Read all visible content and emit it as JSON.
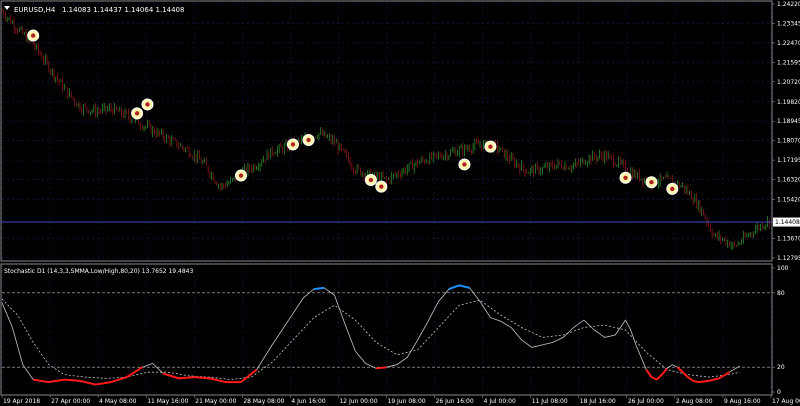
{
  "header": {
    "symbol": "EURUSD,H4",
    "ohlc": "1.14083 1.14437 1.14064 1.14408"
  },
  "indicator": {
    "title": "Stochastic D1 (14,3,3,SMMA,Low/High,80,20) 13.7652 19.4843"
  },
  "colors": {
    "background": "#000000",
    "grid": "#1a1a5a",
    "bull_candle": "#2e8b2e",
    "bear_candle": "#8b1a1a",
    "stoch_main": "#c8c8c8",
    "stoch_signal": "#c8c8c8",
    "overbought_highlight": "#1e90ff",
    "oversold_highlight": "#ff1a1a",
    "level_line": "#bbbbbb",
    "current_price_line": "#4444cc",
    "signal_marker_fill": "#fff6b0"
  },
  "chart_data": [
    {
      "type": "candlestick",
      "panel": "price",
      "ylim": [
        1.1279,
        1.2422
      ],
      "y_ticks": [
        "1.24220",
        "1.23345",
        "1.22470",
        "1.21595",
        "1.20720",
        "1.19820",
        "1.18945",
        "1.18070",
        "1.17195",
        "1.16320",
        "1.15420",
        "1.14408",
        "1.13670",
        "1.12795"
      ],
      "current_price": 1.14408,
      "current_price_label": "1.14408",
      "close_path": [
        [
          0,
          1.239
        ],
        [
          3,
          1.231
        ],
        [
          6,
          1.224
        ],
        [
          9,
          1.214
        ],
        [
          12,
          1.204
        ],
        [
          15,
          1.196
        ],
        [
          18,
          1.194
        ],
        [
          21,
          1.195
        ],
        [
          24,
          1.192
        ],
        [
          27,
          1.188
        ],
        [
          30,
          1.184
        ],
        [
          33,
          1.18
        ],
        [
          36,
          1.176
        ],
        [
          39,
          1.17
        ],
        [
          42,
          1.16
        ],
        [
          44,
          1.162
        ],
        [
          46,
          1.166
        ],
        [
          49,
          1.17
        ],
        [
          52,
          1.176
        ],
        [
          55,
          1.178
        ],
        [
          58,
          1.181
        ],
        [
          61,
          1.184
        ],
        [
          64,
          1.18
        ],
        [
          66,
          1.174
        ],
        [
          68,
          1.168
        ],
        [
          71,
          1.165
        ],
        [
          74,
          1.163
        ],
        [
          77,
          1.167
        ],
        [
          80,
          1.171
        ],
        [
          83,
          1.173
        ],
        [
          86,
          1.175
        ],
        [
          89,
          1.177
        ],
        [
          92,
          1.179
        ],
        [
          95,
          1.178
        ],
        [
          98,
          1.172
        ],
        [
          101,
          1.167
        ],
        [
          104,
          1.168
        ],
        [
          107,
          1.17
        ],
        [
          110,
          1.169
        ],
        [
          113,
          1.173
        ],
        [
          116,
          1.174
        ],
        [
          119,
          1.17
        ],
        [
          122,
          1.165
        ],
        [
          125,
          1.162
        ],
        [
          128,
          1.163
        ],
        [
          131,
          1.16
        ],
        [
          133,
          1.155
        ],
        [
          135,
          1.148
        ],
        [
          137,
          1.138
        ],
        [
          139,
          1.136
        ],
        [
          141,
          1.133
        ],
        [
          143,
          1.137
        ],
        [
          145,
          1.141
        ],
        [
          147,
          1.144
        ]
      ],
      "signals": [
        {
          "x": 6,
          "y": 1.228
        },
        {
          "x": 26,
          "y": 1.193
        },
        {
          "x": 28,
          "y": 1.197
        },
        {
          "x": 46,
          "y": 1.165
        },
        {
          "x": 56,
          "y": 1.179
        },
        {
          "x": 59,
          "y": 1.181
        },
        {
          "x": 71,
          "y": 1.163
        },
        {
          "x": 73,
          "y": 1.16
        },
        {
          "x": 89,
          "y": 1.17
        },
        {
          "x": 94,
          "y": 1.178
        },
        {
          "x": 120,
          "y": 1.164
        },
        {
          "x": 125,
          "y": 1.162
        },
        {
          "x": 129,
          "y": 1.159
        }
      ]
    },
    {
      "type": "line",
      "panel": "stochastic",
      "ylim": [
        0,
        100
      ],
      "y_ticks": [
        "100",
        "80",
        "20",
        "0"
      ],
      "levels": [
        80,
        20
      ],
      "main": [
        [
          0,
          72
        ],
        [
          2,
          52
        ],
        [
          4,
          22
        ],
        [
          6,
          10
        ],
        [
          9,
          8
        ],
        [
          12,
          10
        ],
        [
          15,
          9
        ],
        [
          18,
          6
        ],
        [
          21,
          8
        ],
        [
          24,
          12
        ],
        [
          27,
          20
        ],
        [
          29,
          23
        ],
        [
          31,
          15
        ],
        [
          34,
          11
        ],
        [
          37,
          12
        ],
        [
          40,
          11
        ],
        [
          43,
          8
        ],
        [
          46,
          8
        ],
        [
          49,
          18
        ],
        [
          52,
          38
        ],
        [
          55,
          57
        ],
        [
          58,
          76
        ],
        [
          60,
          83
        ],
        [
          62,
          84
        ],
        [
          64,
          78
        ],
        [
          66,
          55
        ],
        [
          68,
          33
        ],
        [
          70,
          23
        ],
        [
          72,
          19
        ],
        [
          74,
          20
        ],
        [
          76,
          22
        ],
        [
          78,
          28
        ],
        [
          80,
          42
        ],
        [
          82,
          57
        ],
        [
          84,
          73
        ],
        [
          86,
          83
        ],
        [
          88,
          86
        ],
        [
          90,
          84
        ],
        [
          92,
          73
        ],
        [
          94,
          60
        ],
        [
          96,
          57
        ],
        [
          98,
          52
        ],
        [
          100,
          42
        ],
        [
          102,
          36
        ],
        [
          104,
          38
        ],
        [
          106,
          40
        ],
        [
          108,
          44
        ],
        [
          110,
          52
        ],
        [
          112,
          58
        ],
        [
          114,
          50
        ],
        [
          116,
          44
        ],
        [
          118,
          46
        ],
        [
          120,
          58
        ],
        [
          121,
          50
        ],
        [
          122,
          38
        ],
        [
          123,
          28
        ],
        [
          124,
          18
        ],
        [
          125,
          12
        ],
        [
          126,
          10
        ],
        [
          127,
          14
        ],
        [
          128,
          19
        ],
        [
          129,
          22
        ],
        [
          130,
          20
        ],
        [
          131,
          16
        ],
        [
          132,
          12
        ],
        [
          133,
          9
        ],
        [
          134,
          8
        ],
        [
          136,
          9
        ],
        [
          138,
          11
        ],
        [
          140,
          16
        ],
        [
          142,
          21
        ]
      ],
      "signal": [
        [
          0,
          75
        ],
        [
          3,
          62
        ],
        [
          6,
          40
        ],
        [
          9,
          22
        ],
        [
          12,
          14
        ],
        [
          16,
          12
        ],
        [
          20,
          11
        ],
        [
          24,
          12
        ],
        [
          28,
          16
        ],
        [
          32,
          16
        ],
        [
          36,
          13
        ],
        [
          40,
          12
        ],
        [
          44,
          10
        ],
        [
          48,
          12
        ],
        [
          52,
          24
        ],
        [
          56,
          42
        ],
        [
          60,
          60
        ],
        [
          64,
          70
        ],
        [
          68,
          58
        ],
        [
          72,
          40
        ],
        [
          76,
          30
        ],
        [
          80,
          34
        ],
        [
          84,
          52
        ],
        [
          88,
          70
        ],
        [
          92,
          74
        ],
        [
          96,
          62
        ],
        [
          100,
          52
        ],
        [
          104,
          44
        ],
        [
          108,
          46
        ],
        [
          112,
          52
        ],
        [
          116,
          54
        ],
        [
          120,
          50
        ],
        [
          124,
          32
        ],
        [
          128,
          18
        ],
        [
          132,
          14
        ],
        [
          136,
          12
        ],
        [
          140,
          14
        ],
        [
          142,
          16
        ]
      ],
      "x_labels": [
        "19 Apr 2018",
        "27 Apr 00:00",
        "4 May 08:00",
        "11 May 16:00",
        "21 May 00:00",
        "28 May 08:00",
        "4 Jun 16:00",
        "12 Jun 00:00",
        "19 Jun 08:00",
        "26 Jun 16:00",
        "4 Jul 00:00",
        "11 Jul 08:00",
        "18 Jul 16:00",
        "26 Jul 00:00",
        "2 Aug 08:00",
        "9 Aug 16:00",
        "17 Aug 00:00"
      ]
    }
  ]
}
